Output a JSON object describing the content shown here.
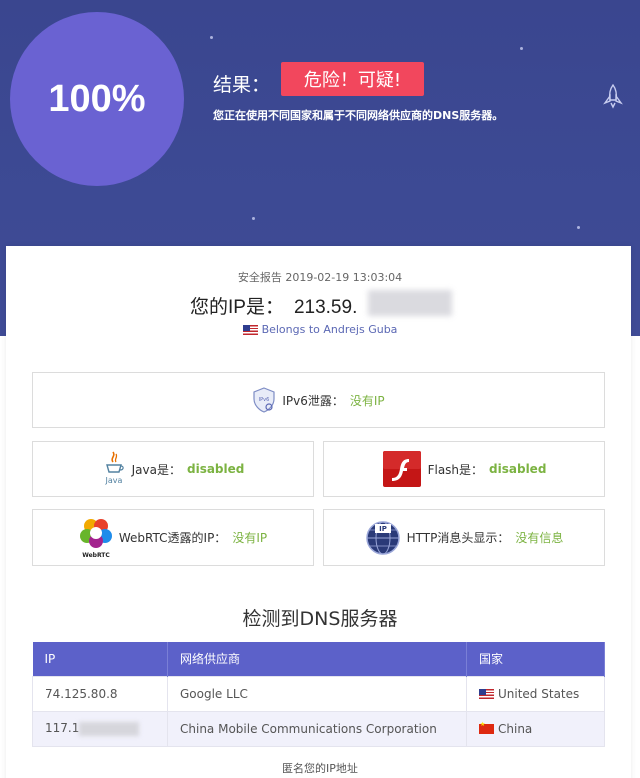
{
  "hero": {
    "score": "100%",
    "result_label": "结果：",
    "result_badge": "危险！可疑!",
    "description": "您正在使用不同国家和属于不同网络供应商的DNS服务器。"
  },
  "report": {
    "time": "安全报告 2019-02-19 13:03:04",
    "ip_label": "您的IP是：",
    "ip_value": "213.59.",
    "belongs": "Belongs to Andrejs Guba"
  },
  "checks": {
    "ipv6": {
      "label": "IPv6泄露：",
      "value": "没有IP"
    },
    "java": {
      "label": "Java是：",
      "value": "disabled",
      "icon_text": "Java"
    },
    "flash": {
      "label": "Flash是：",
      "value": "disabled"
    },
    "webrtc": {
      "label": "WebRTC透露的IP：",
      "value": "没有IP",
      "icon_text": "WebRTC"
    },
    "http": {
      "label": "HTTP消息头显示：",
      "value": "没有信息"
    }
  },
  "dns": {
    "title": "检测到DNS服务器",
    "headers": [
      "IP",
      "网络供应商",
      "国家"
    ],
    "rows": [
      {
        "ip": "74.125.80.8",
        "isp": "Google LLC",
        "country": "United States"
      },
      {
        "ip": "117.1",
        "isp": "China Mobile Communications Corporation",
        "country": "China"
      }
    ]
  },
  "footer": {
    "anon_link": "匿名您的IP地址"
  },
  "colors": {
    "hero_bg": "#3d4a94",
    "circle": "#6a62d2",
    "danger": "#f2475d",
    "ok_green": "#7cb342",
    "table_header": "#5c61c9"
  }
}
